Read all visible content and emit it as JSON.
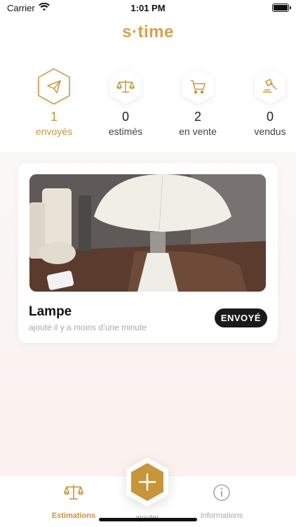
{
  "status_bar": {
    "carrier": "Carrier",
    "time": "1:01 PM"
  },
  "app": {
    "logo": "s·time",
    "accent_color": "#c8953b"
  },
  "stats": [
    {
      "count": "1",
      "label": "envoyés",
      "icon": "paper-plane-icon",
      "active": true
    },
    {
      "count": "0",
      "label": "estimés",
      "icon": "scales-icon",
      "active": false
    },
    {
      "count": "2",
      "label": "en vente",
      "icon": "cart-icon",
      "active": false
    },
    {
      "count": "0",
      "label": "vendus",
      "icon": "gavel-icon",
      "active": false
    }
  ],
  "items": [
    {
      "title": "Lampe",
      "subtitle": "ajouté il y a moins d’une minute",
      "badge": "ENVOYÉ"
    }
  ],
  "tabbar": {
    "estimations": "Estimations",
    "add": "ajouter",
    "informations": "Informations"
  }
}
